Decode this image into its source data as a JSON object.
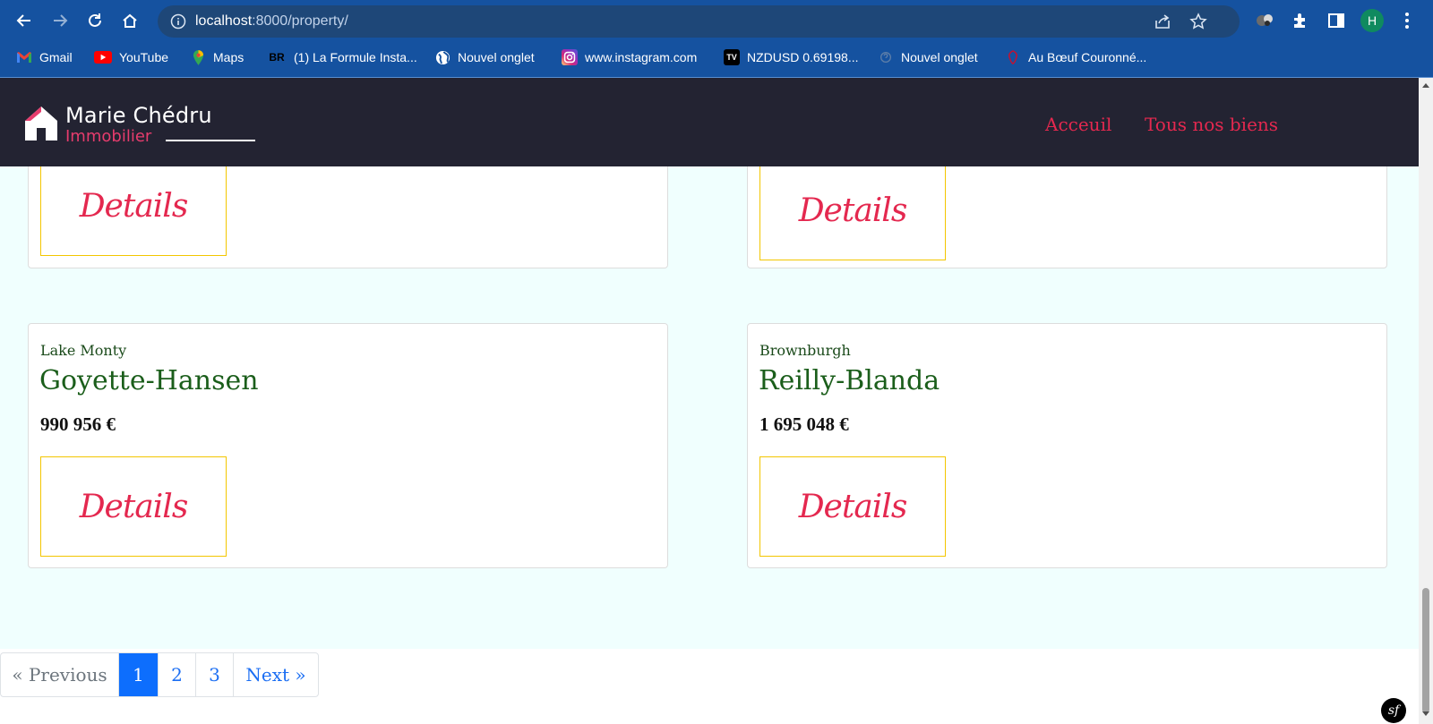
{
  "browser": {
    "url_host": "localhost",
    "url_path": ":8000/property/",
    "profile_initial": "H",
    "bookmarks": [
      {
        "label": "Gmail",
        "icon": "gmail-icon"
      },
      {
        "label": "YouTube",
        "icon": "youtube-icon"
      },
      {
        "label": "Maps",
        "icon": "maps-icon"
      },
      {
        "label": "(1) La Formule Insta...",
        "icon": "br-icon",
        "icon_text": "BR"
      },
      {
        "label": "Nouvel onglet",
        "icon": "globe-icon"
      },
      {
        "label": "www.instagram.com",
        "icon": "instagram-icon"
      },
      {
        "label": "NZDUSD 0.69198...",
        "icon": "tradingview-icon",
        "icon_text": "TV"
      },
      {
        "label": "Nouvel onglet",
        "icon": "page-icon"
      },
      {
        "label": "Au Bœuf Couronné...",
        "icon": "boeuf-icon"
      }
    ]
  },
  "site": {
    "logo_name": "Marie Chédru",
    "logo_sub": "Immobilier",
    "nav": [
      "Acceuil",
      "Tous nos biens"
    ],
    "brand_color": "#e4284f",
    "header_bg": "#232332"
  },
  "cards": [
    {
      "city": "",
      "title": "",
      "price": "",
      "button": "Details"
    },
    {
      "city": "",
      "title": "",
      "price": "",
      "button": "Details"
    },
    {
      "city": "Lake Monty",
      "title": "Goyette-Hansen",
      "price": "990 956 €",
      "button": "Details"
    },
    {
      "city": "Brownburgh",
      "title": "Reilly-Blanda",
      "price": "1 695 048 €",
      "button": "Details"
    }
  ],
  "pagination": {
    "previous": "« Previous",
    "pages": [
      "1",
      "2",
      "3"
    ],
    "active_page": "1",
    "next": "Next »"
  },
  "debug_badge": "sf"
}
